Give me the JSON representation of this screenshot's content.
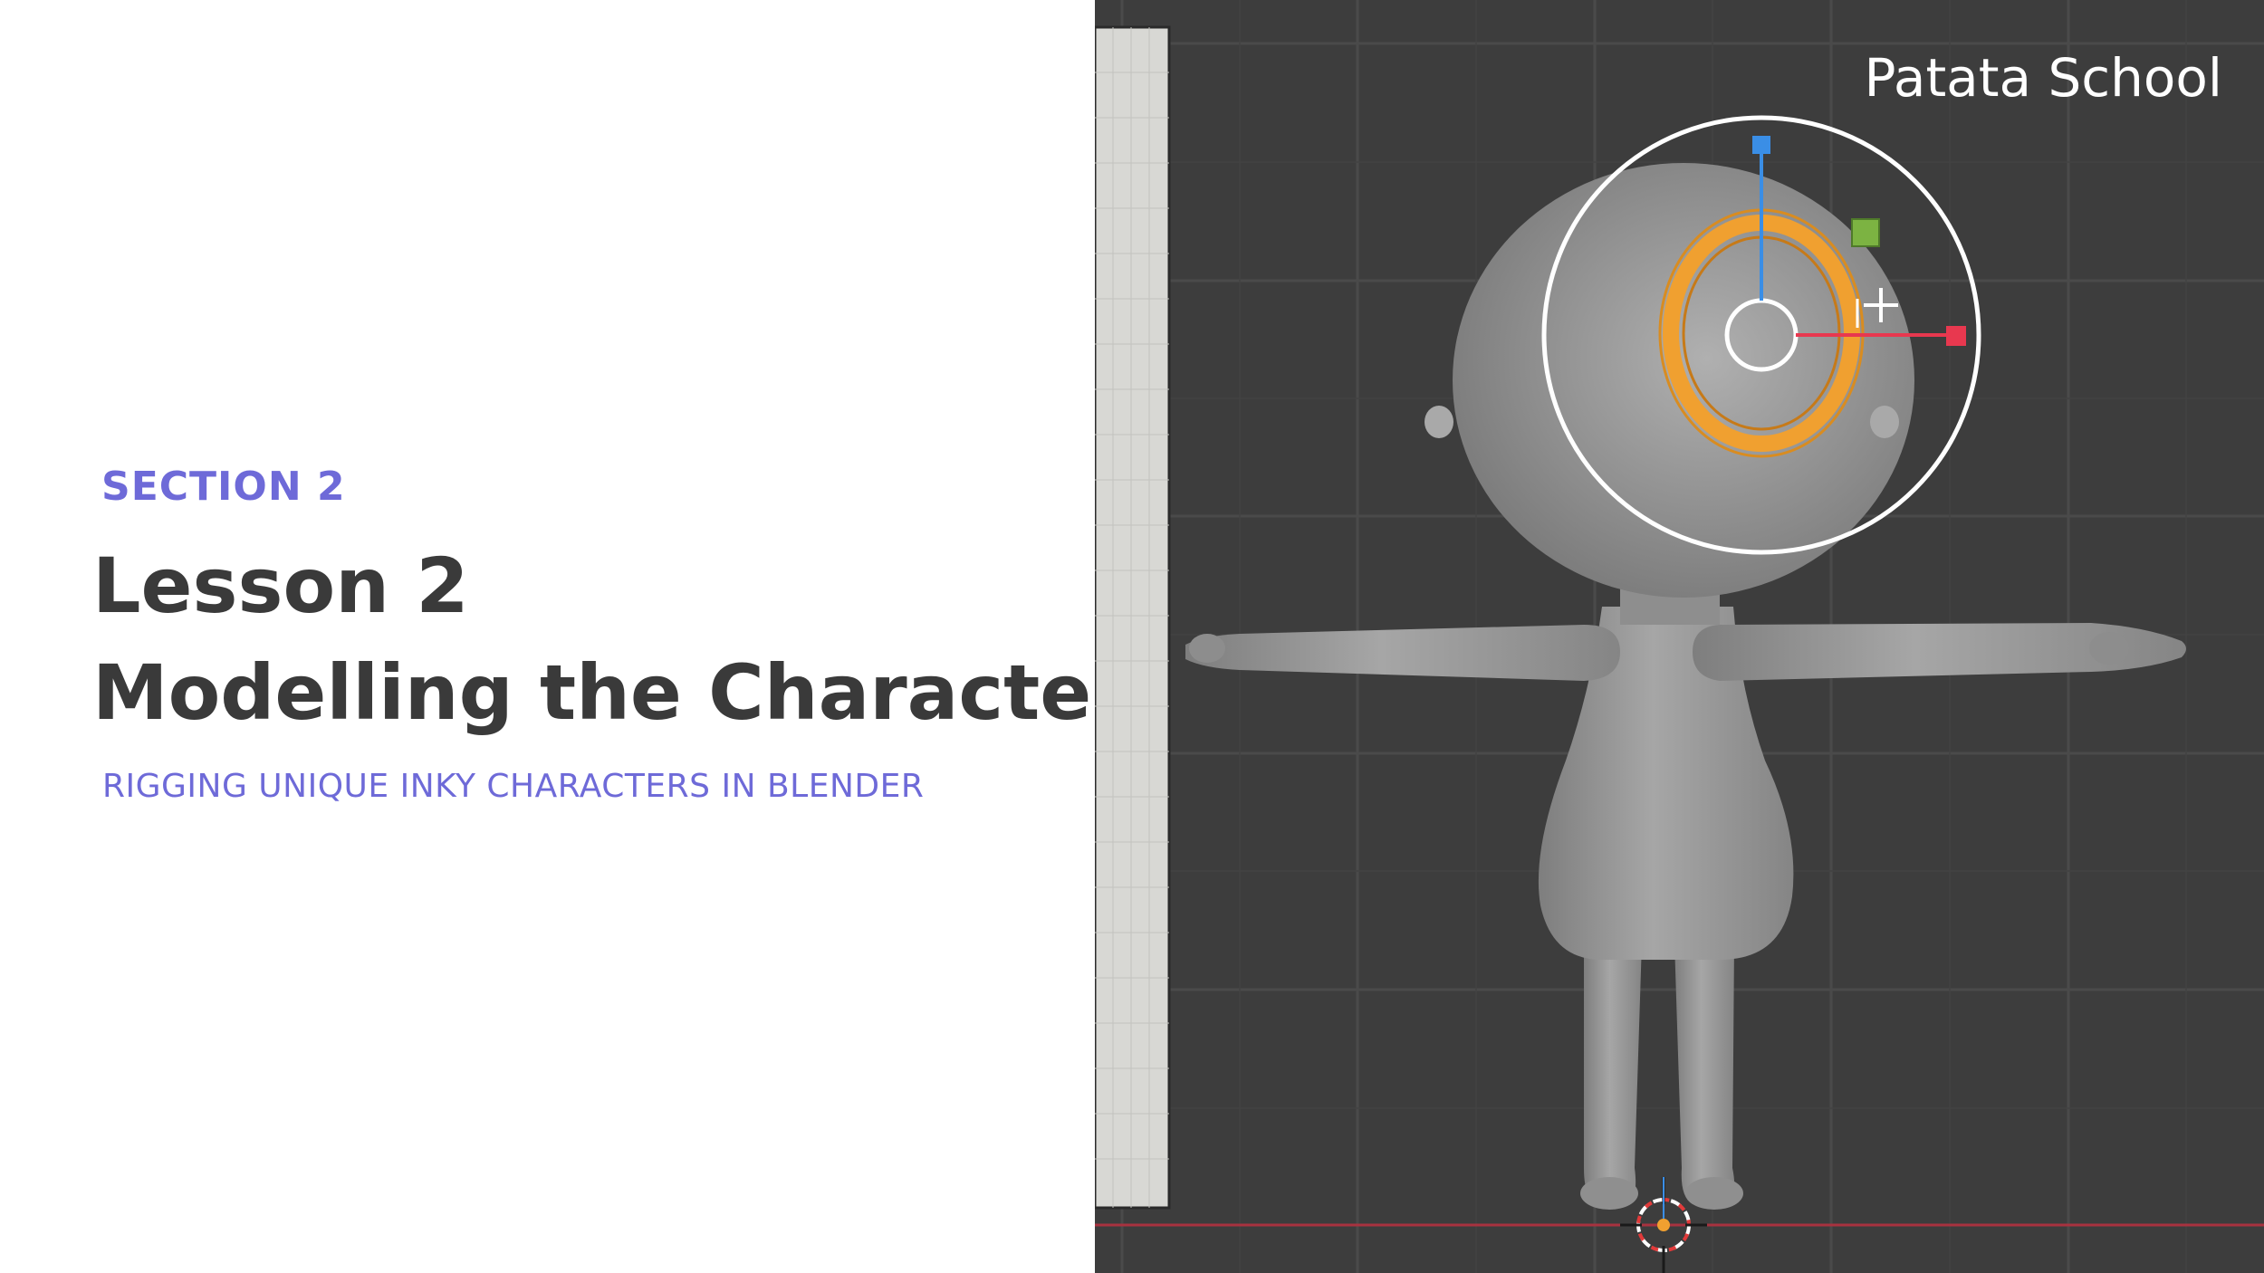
{
  "slide": {
    "section_label": "SECTION 2",
    "lesson_line": "Lesson 2",
    "title_line": "Modelling the Character",
    "course_name": "RIGGING UNIQUE INKY CHARACTERS IN BLENDER"
  },
  "viewport": {
    "brand": "Patata School",
    "colors": {
      "background": "#3d3d3d",
      "grid": "#4a4a4a",
      "mesh": "#9a9a9a",
      "selection": "#f0a030",
      "gizmo_x": "#e8384f",
      "gizmo_z": "#3a8ee6",
      "gizmo_plane": "#7cb342"
    },
    "icons": [
      "3d-cursor-icon",
      "move-cursor-icon"
    ]
  }
}
